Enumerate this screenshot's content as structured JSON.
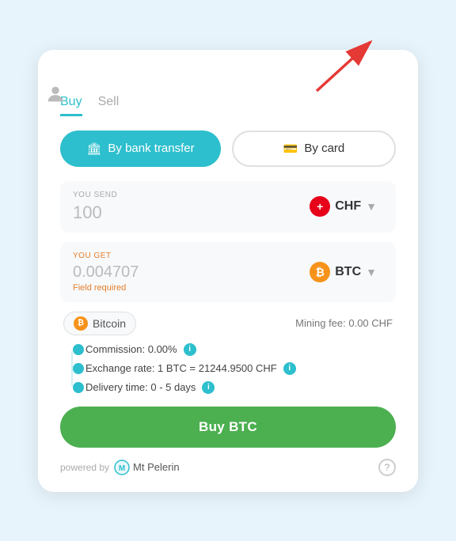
{
  "tabs": [
    {
      "id": "buy",
      "label": "Buy",
      "active": true
    },
    {
      "id": "sell",
      "label": "Sell",
      "active": false
    }
  ],
  "payment": {
    "bank_transfer_label": "By bank transfer",
    "by_card_label": "By card"
  },
  "send": {
    "label": "YOU SEND",
    "value": "100",
    "currency": {
      "code": "CHF",
      "flag_symbol": "+"
    }
  },
  "get": {
    "label": "YOU GET",
    "value": "0.004707",
    "field_required": "Field required",
    "currency": {
      "code": "BTC",
      "symbol": "₿"
    }
  },
  "info_row": {
    "coin_name": "Bitcoin",
    "mining_fee": "Mining fee: 0.00 CHF"
  },
  "details": [
    {
      "text": "Commission: 0.00%",
      "has_info": true
    },
    {
      "text": "Exchange rate: 1 BTC = 21244.9500 CHF",
      "has_info": true
    },
    {
      "text": "Delivery time: 0 - 5 days",
      "has_info": true
    }
  ],
  "buy_button": {
    "label": "Buy BTC"
  },
  "footer": {
    "powered_by": "powered by",
    "brand": "Mt\nPelerin",
    "help_symbol": "?"
  },
  "icons": {
    "bank": "🏛",
    "card": "💳",
    "user": "👤",
    "info": "i",
    "btc": "₿",
    "chf_sign": "+"
  }
}
